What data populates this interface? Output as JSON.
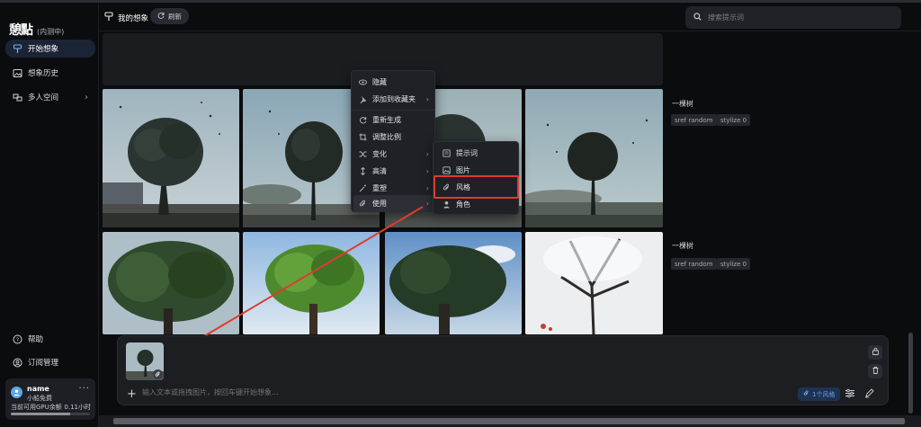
{
  "app": {
    "logo": "憩點",
    "beta": "(内测中)"
  },
  "sidebar": {
    "items": [
      {
        "label": "开始想象",
        "icon": "brush-icon"
      },
      {
        "label": "想象历史",
        "icon": "image-icon"
      },
      {
        "label": "多人空间",
        "icon": "people-icon"
      }
    ],
    "bottom": [
      {
        "label": "帮助",
        "icon": "help-icon"
      },
      {
        "label": "订阅管理",
        "icon": "user-circle-icon"
      }
    ],
    "user": {
      "name": "name",
      "plan": "小船免费",
      "gpu_label": "当前可用GPU余额",
      "gpu_value": "0.11小时",
      "gpu_fraction": 0.75
    }
  },
  "header": {
    "title": "我的想象",
    "refresh": "刷新",
    "search_placeholder": "搜索提示词"
  },
  "results": [
    {
      "title": "一棵树",
      "tags": [
        "sref random",
        "stylize 0"
      ]
    },
    {
      "title": "一棵树",
      "tags": [
        "sref random",
        "stylize 0"
      ]
    }
  ],
  "context_menu": {
    "items": [
      {
        "label": "隐藏",
        "icon": "eye-icon",
        "submenu": false
      },
      {
        "label": "添加到收藏夹",
        "icon": "pin-icon",
        "submenu": true
      },
      {
        "label": "重新生成",
        "icon": "refresh-icon",
        "submenu": false
      },
      {
        "label": "调整比例",
        "icon": "crop-icon",
        "submenu": false
      },
      {
        "label": "变化",
        "icon": "shuffle-icon",
        "submenu": true
      },
      {
        "label": "高清",
        "icon": "expand-icon",
        "submenu": true
      },
      {
        "label": "重塑",
        "icon": "wand-icon",
        "submenu": true
      },
      {
        "label": "使用",
        "icon": "clip-icon",
        "submenu": true
      }
    ],
    "submenu": [
      {
        "label": "提示词",
        "icon": "text-icon"
      },
      {
        "label": "图片",
        "icon": "picture-icon"
      },
      {
        "label": "风格",
        "icon": "clip-icon"
      },
      {
        "label": "角色",
        "icon": "person-icon"
      }
    ]
  },
  "prompt_bar": {
    "placeholder": "输入文本或拖拽图片，按回车键开始想象...",
    "style_button": "1个风格"
  }
}
